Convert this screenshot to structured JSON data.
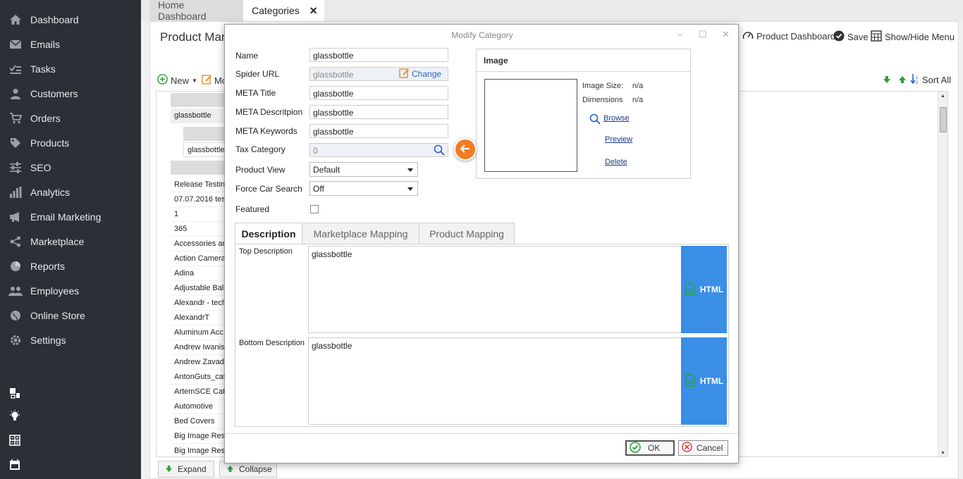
{
  "sidebar": {
    "items": [
      {
        "label": "Dashboard",
        "icon": "home-icon"
      },
      {
        "label": "Emails",
        "icon": "envelope-icon"
      },
      {
        "label": "Tasks",
        "icon": "tasks-icon"
      },
      {
        "label": "Customers",
        "icon": "user-icon"
      },
      {
        "label": "Orders",
        "icon": "cart-icon"
      },
      {
        "label": "Products",
        "icon": "tag-icon"
      },
      {
        "label": "SEO",
        "icon": "sliders-icon"
      },
      {
        "label": "Analytics",
        "icon": "bar-chart-icon"
      },
      {
        "label": "Email Marketing",
        "icon": "megaphone-icon"
      },
      {
        "label": "Marketplace",
        "icon": "share-icon"
      },
      {
        "label": "Reports",
        "icon": "pie-chart-icon"
      },
      {
        "label": "Employees",
        "icon": "users-icon"
      },
      {
        "label": "Online Store",
        "icon": "globe-icon"
      },
      {
        "label": "Settings",
        "icon": "gear-icon"
      }
    ]
  },
  "tabs": {
    "home": "Home Dashboard",
    "categories": "Categories",
    "close": "✕"
  },
  "page": {
    "title": "Product Man",
    "product_dashboard": "Product Dashboard",
    "save": "Save",
    "show_hide_menu": "Show/Hide Menu",
    "new": "New",
    "modify_partial": "Mo",
    "sort_all": "Sort All",
    "expand": "Expand",
    "collapse": "Collapse"
  },
  "grid": {
    "tree_row_1": "glassbottle",
    "tree_row_2": "glassbottle",
    "rows": [
      "Release Testin",
      "07.07.2016 test",
      "1",
      "365",
      "Accessories an",
      "Action Camera",
      "Adina",
      "Adjustable Bal",
      "Alexandr - tech",
      "AlexandrT",
      "Aluminum Acc",
      "Andrew Iwanis",
      "Andrew Zavads",
      "AntonGuts_cat",
      "ArtemSCE Cate",
      "Automotive",
      "Bed Covers",
      "Big Image Res",
      "Big Image Res"
    ]
  },
  "modal": {
    "title": "Modify Category",
    "minimize": "–",
    "maximize": "☐",
    "close": "✕",
    "fields": {
      "name_label": "Name",
      "name_value": "glassbottle",
      "spider_label": "Spider URL",
      "spider_value": "glassbottle",
      "change": "Change",
      "meta_title_label": "META Title",
      "meta_title_value": "glassbottle",
      "meta_desc_label": "META Descritpion",
      "meta_desc_value": "glassbottle",
      "meta_kw_label": "META Keywords",
      "meta_kw_value": "glassbottle",
      "tax_label": "Tax Category",
      "tax_value": "0",
      "product_view_label": "Product View",
      "product_view_value": "Default",
      "force_car_label": "Force Car Search",
      "force_car_value": "Off",
      "featured_label": "Featured"
    },
    "image": {
      "title": "Image",
      "size_label": "Image Size:",
      "size_value": "n/a",
      "dim_label": "Dimensions",
      "dim_value": "n/a",
      "browse": "Browse",
      "preview": "Preview",
      "delete": "Delete"
    },
    "desc_tabs": [
      "Description",
      "Marketplace Mapping",
      "Product Mapping"
    ],
    "top_desc_label": "Top Description",
    "top_desc_value": "glassbottle",
    "bottom_desc_label": "Bottom Description",
    "bottom_desc_value": "glassbottle",
    "html": "HTML",
    "ok": "OK",
    "cancel": "Cancel"
  },
  "colors": {
    "sidebar_bg": "#2b2f36",
    "accent_orange": "#f47a20",
    "html_button": "#3a8ee6",
    "link_blue": "#1b3a8f",
    "green": "#2e9e3b"
  }
}
